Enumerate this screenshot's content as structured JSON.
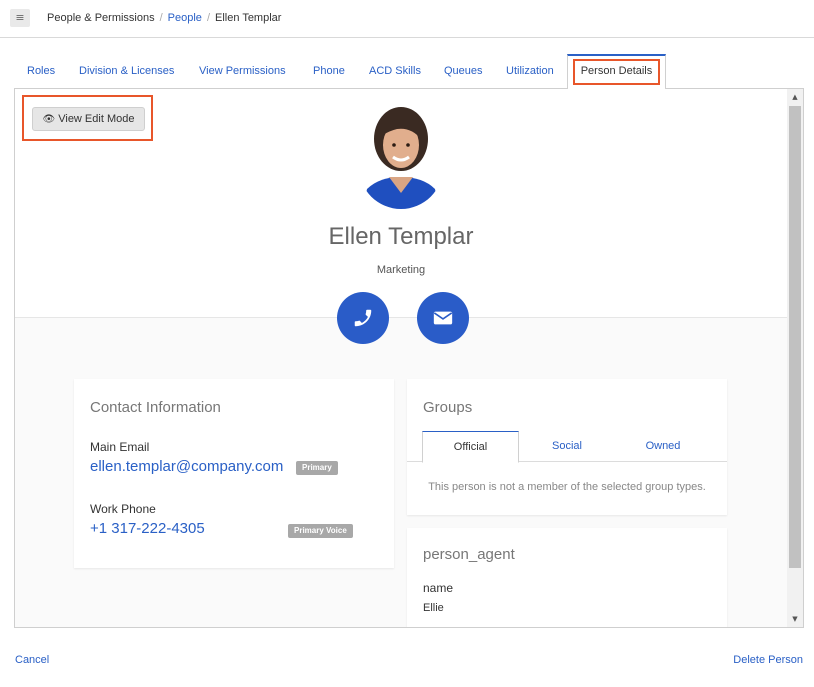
{
  "breadcrumb": {
    "items": [
      {
        "label": "People & Permissions",
        "link": false
      },
      {
        "label": "People",
        "link": true
      },
      {
        "label": "Ellen Templar",
        "link": false
      }
    ],
    "separator": "/"
  },
  "tabs": [
    {
      "label": "Roles"
    },
    {
      "label": "Division & Licenses"
    },
    {
      "label": "View Permissions"
    },
    {
      "label": "Phone"
    },
    {
      "label": "ACD Skills"
    },
    {
      "label": "Queues"
    },
    {
      "label": "Utilization"
    },
    {
      "label": "Person Details",
      "active": true
    }
  ],
  "profile": {
    "edit_button_label": "View Edit Mode",
    "name": "Ellen Templar",
    "department": "Marketing"
  },
  "contact": {
    "title": "Contact Information",
    "email_label": "Main Email",
    "email_value": "ellen.templar@company.com",
    "email_badge": "Primary",
    "phone_label": "Work Phone",
    "phone_value": "+1 317-222-4305",
    "phone_badge": "Primary Voice"
  },
  "groups": {
    "title": "Groups",
    "tabs": [
      "Official",
      "Social",
      "Owned"
    ],
    "active_tab": "Official",
    "empty_message": "This person is not a member of the selected group types."
  },
  "person_agent": {
    "title": "person_agent",
    "field_label": "name",
    "field_value": "Ellie"
  },
  "footer": {
    "cancel_label": "Cancel",
    "delete_label": "Delete Person"
  },
  "colors": {
    "accent": "#2a60c6",
    "highlight": "#e8562a",
    "badge": "#a8a8a8"
  },
  "icons": {
    "menu": "hamburger-icon",
    "edit": "eye-icon",
    "call": "phone-icon",
    "email": "envelope-icon"
  }
}
